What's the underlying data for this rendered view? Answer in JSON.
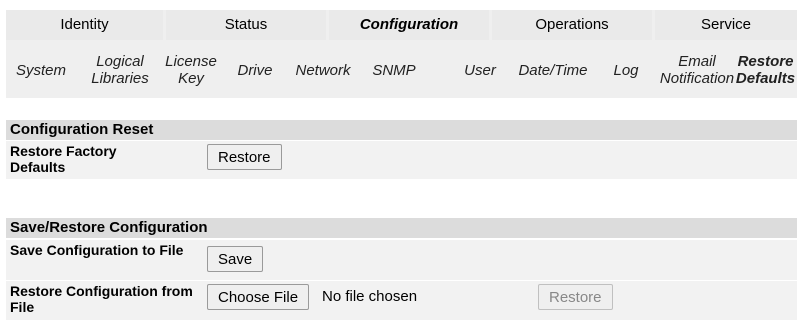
{
  "nav": {
    "tabs": [
      "Identity",
      "Status",
      "Configuration",
      "Operations",
      "Service"
    ],
    "active_tab": "Configuration",
    "subtabs": [
      "System",
      "Logical Libraries",
      "License Key",
      "Drive",
      "Network",
      "SNMP",
      "User",
      "Date/Time",
      "Log",
      "Email Notification",
      "Restore Defaults"
    ],
    "active_subtab": "Restore Defaults"
  },
  "config_reset": {
    "header": "Configuration Reset",
    "restore_factory_label": "Restore Factory Defaults",
    "restore_button": "Restore"
  },
  "save_restore": {
    "header": "Save/Restore Configuration",
    "save_label": "Save Configuration to File",
    "save_button": "Save",
    "restore_label": "Restore Configuration from File",
    "choose_file_button": "Choose File",
    "file_status": "No file chosen",
    "restore_button": "Restore"
  }
}
